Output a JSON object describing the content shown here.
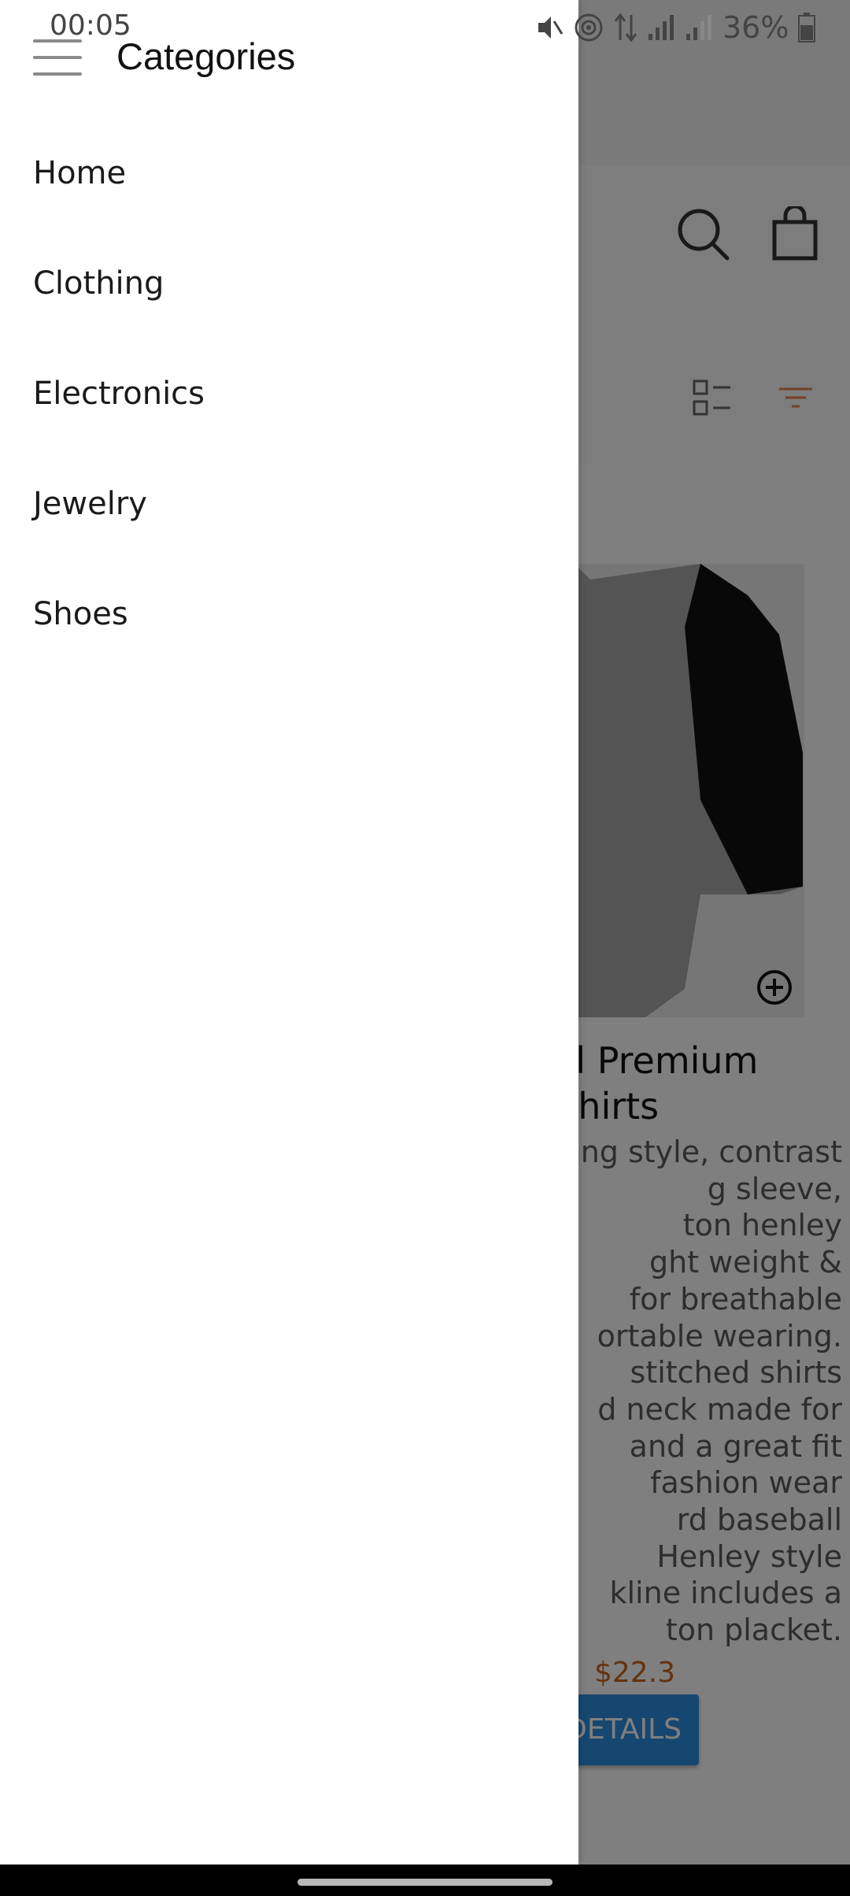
{
  "status_bar": {
    "time": "00:05",
    "battery": "36%"
  },
  "drawer": {
    "title": "Categories",
    "items": [
      {
        "label": "Home"
      },
      {
        "label": "Clothing"
      },
      {
        "label": "Electronics"
      },
      {
        "label": "Jewelry"
      },
      {
        "label": "Shoes"
      }
    ]
  },
  "background": {
    "product_title": "sual Premium\n T-Shirts",
    "product_description": "ng style, contrast\ng sleeve,\nton henley\nght weight &\n for breathable\nortable wearing.\nstitched shirts\nd neck made for\n and a great fit\n fashion wear\nrd baseball\nHenley style\nkline includes a\nton placket.",
    "price": "$22.3",
    "button_label": "DETAILS"
  },
  "icons": {
    "menu": "hamburger-icon",
    "search": "search-icon",
    "cart": "shopping-bag-icon",
    "list_view": "list-view-icon",
    "filter": "filter-icon",
    "add": "add-circle-icon"
  },
  "colors": {
    "accent": "#2d8fe0",
    "price": "#c8641c",
    "filter": "#e8844a"
  }
}
